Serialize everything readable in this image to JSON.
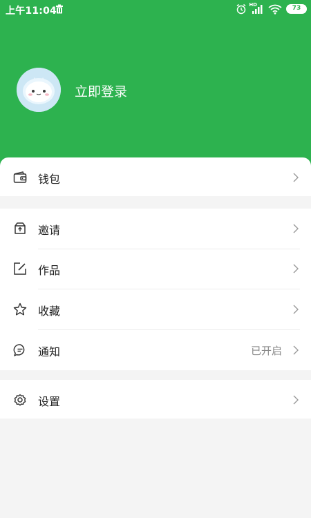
{
  "status_bar": {
    "time": "上午11:04",
    "network_label": "HD",
    "battery": "73"
  },
  "colors": {
    "accent": "#2db24f",
    "background": "#f4f4f4"
  },
  "profile": {
    "login_label": "立即登录"
  },
  "menu": {
    "wallet": {
      "label": "钱包",
      "icon": "wallet-icon"
    },
    "invite": {
      "label": "邀请",
      "icon": "invite-box-icon"
    },
    "works": {
      "label": "作品",
      "icon": "edit-icon"
    },
    "favorites": {
      "label": "收藏",
      "icon": "star-icon"
    },
    "notifications": {
      "label": "通知",
      "value": "已开启",
      "icon": "chat-bubble-icon"
    },
    "settings": {
      "label": "设置",
      "icon": "gear-icon"
    }
  }
}
